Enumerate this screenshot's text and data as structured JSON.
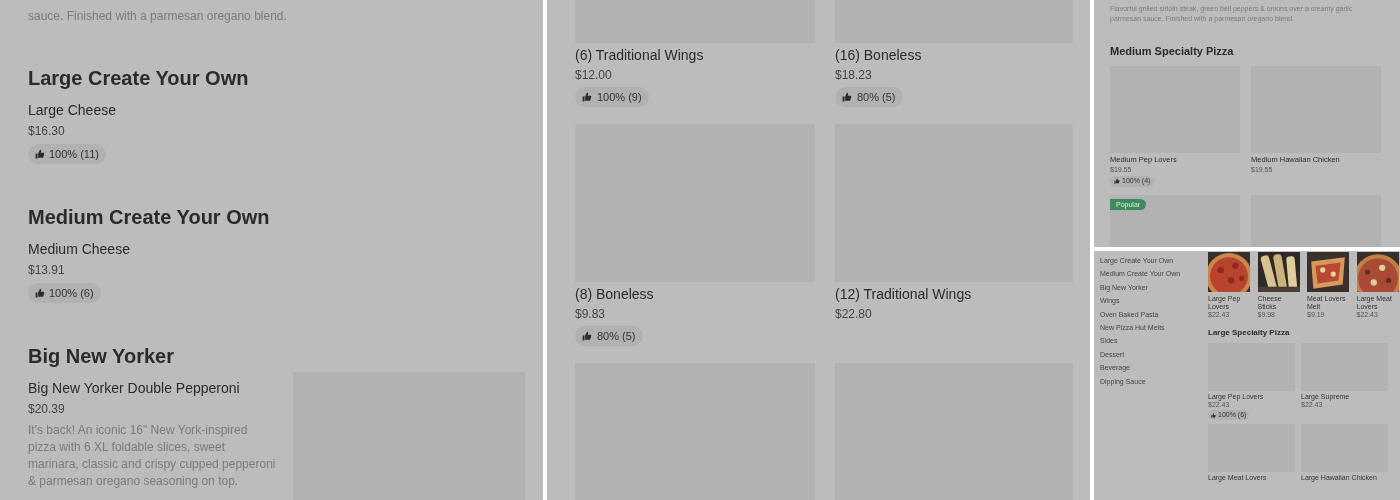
{
  "panels": [
    {
      "kind": "menu_list",
      "top_description": "sauce. Finished with a parmesan oregano blend.",
      "sections": [
        {
          "title": "Large Create Your Own",
          "items": [
            {
              "name": "Large Cheese",
              "price": "$16.30",
              "rating": "100% (11)"
            }
          ]
        },
        {
          "title": "Medium Create Your Own",
          "items": [
            {
              "name": "Medium Cheese",
              "price": "$13.91",
              "rating": "100% (6)"
            }
          ]
        },
        {
          "title": "Big New Yorker",
          "items": [
            {
              "name": "Big New Yorker Double Pepperoni",
              "price": "$20.39",
              "description": "It's back! An iconic 16\" New York-inspired pizza with 6 XL foldable slices, sweet marinara, classic and crispy cupped pepperoni & parmesan oregano seasoning on top.",
              "kind": "placeholder"
            }
          ]
        }
      ]
    },
    {
      "kind": "card_grid",
      "cards": [
        {
          "name": "(6) Traditional Wings",
          "price": "$12.00",
          "rating": "100% (9)",
          "kind": "placeholder"
        },
        {
          "name": "(16) Boneless",
          "price": "$18.23",
          "rating": "80% (5)",
          "kind": "placeholder"
        },
        {
          "name": "(8) Boneless",
          "price": "$9.83",
          "rating": "80% (5)",
          "kind": "placeholder"
        },
        {
          "name": "(12) Traditional Wings",
          "price": "$22.80",
          "kind": "placeholder"
        },
        {
          "kind": "placeholder"
        },
        {
          "kind": "placeholder"
        }
      ]
    },
    {
      "kind": "section_grid",
      "top_description": "Flavorful grilled sirloin steak, green bell peppers & onions over a creamy garlic parmesan sauce. Finished with a parmesan oregano blend.",
      "title": "Medium Specialty Pizza",
      "cards": [
        {
          "name": "Medium Pep Lovers",
          "price": "$19.55",
          "rating": "100% (4)",
          "kind": "placeholder"
        },
        {
          "name": "Medium Hawaiian Chicken",
          "price": "$19.55",
          "kind": "placeholder"
        },
        {
          "badge": "Popular",
          "kind": "placeholder"
        },
        {
          "kind": "placeholder"
        }
      ]
    },
    {
      "kind": "sidebar_layout",
      "sidebar": [
        "Large Create Your Own",
        "Medium Create Your Own",
        "Big New Yorker",
        "Wings",
        "Oven Baked Pasta",
        "New Pizza Hut Melts",
        "Sides",
        "Dessert",
        "Beverage",
        "Dipping Sauce"
      ],
      "carousel": [
        {
          "name": "Large Pep Lovers",
          "price": "$22.43"
        },
        {
          "name": "Cheese Sticks",
          "price": "$9.98"
        },
        {
          "name": "Meat Lovers Melt",
          "price": "$9.19"
        },
        {
          "name": "Large Meat Lovers",
          "price": "$22.43"
        }
      ],
      "title": "Large Specialty Pizza",
      "cards": [
        {
          "name": "Large Pep Lovers",
          "price": "$22.43",
          "rating": "100% (6)",
          "kind": "placeholder"
        },
        {
          "name": "Large Supreme",
          "price": "$22.43",
          "kind": "placeholder"
        },
        {
          "name": "Large Meat Lovers",
          "kind": "placeholder"
        },
        {
          "name": "Large Hawaiian Chicken",
          "kind": "placeholder"
        }
      ]
    }
  ]
}
